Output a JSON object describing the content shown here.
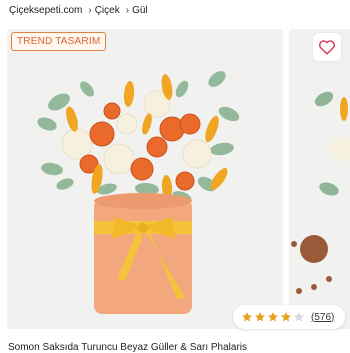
{
  "breadcrumb": {
    "items": [
      "Çiçeksepeti.com",
      "Çiçek",
      "Gül"
    ]
  },
  "product": {
    "badge": "TREND TASARIM",
    "title": "Somon Saksıda Turuncu Beyaz Güller & Sarı Phalaris",
    "rating": {
      "stars": 4,
      "max": 5,
      "count_label": "(576)"
    }
  },
  "colors": {
    "badge_border": "#e0833f",
    "badge_text": "#d9642a",
    "star_filled": "#e8a11a",
    "star_empty": "#d9d9d9",
    "heart": "#d9365e",
    "pot": "#f2a77e",
    "ribbon": "#f5c33b"
  },
  "icons": {
    "favorite": "heart-outline-icon",
    "breadcrumb_separator": "chevron-right-icon"
  }
}
